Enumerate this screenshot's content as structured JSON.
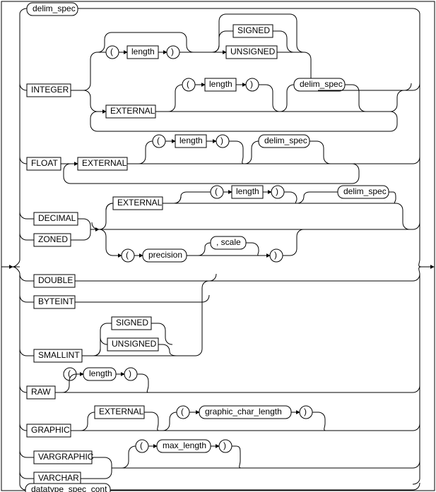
{
  "header": {
    "delim_spec": "delim_spec"
  },
  "integer": {
    "keyword": "INTEGER",
    "lparen": "(",
    "length": "length",
    "rparen": ")",
    "signed": "SIGNED",
    "unsigned": "UNSIGNED",
    "external": "EXTERNAL",
    "lparen2": "(",
    "length2": "length",
    "rparen2": ")",
    "delim_spec": "delim_spec"
  },
  "float": {
    "keyword": "FLOAT",
    "external": "EXTERNAL",
    "lparen": "(",
    "length": "length",
    "rparen": ")",
    "delim_spec": "delim_spec"
  },
  "decimal": {
    "decimal": "DECIMAL",
    "zoned": "ZONED",
    "external": "EXTERNAL",
    "lparen": "(",
    "length": "length",
    "rparen": ")",
    "delim_spec": "delim_spec",
    "lparen2": "(",
    "precision": "precision",
    "scale": ", scale",
    "rparen2": ")"
  },
  "simple": {
    "double": "DOUBLE",
    "byteint": "BYTEINT",
    "smallint": "SMALLINT",
    "signed": "SIGNED",
    "unsigned": "UNSIGNED"
  },
  "raw": {
    "keyword": "RAW",
    "lparen": "(",
    "length": "length",
    "rparen": ")"
  },
  "graphic": {
    "keyword": "GRAPHIC",
    "external": "EXTERNAL",
    "lparen": "(",
    "gcl": "graphic_char_length",
    "rparen": ")"
  },
  "vargraphic": {
    "vargraphic": "VARGRAPHIC",
    "varchar": "VARCHAR",
    "lparen": "(",
    "max_length": "max_length",
    "rparen": ")"
  },
  "footer": {
    "cont": "datatype_spec_cont"
  }
}
